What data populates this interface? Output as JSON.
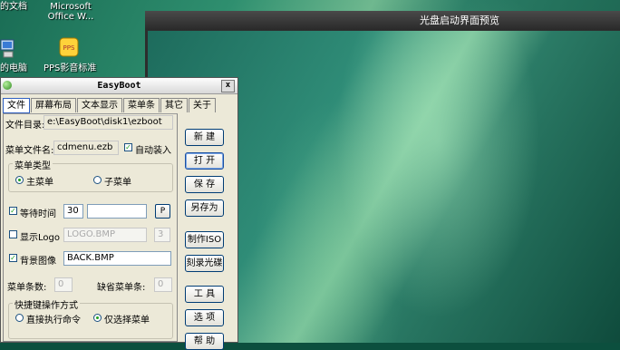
{
  "desktop": {
    "icons": [
      {
        "name": "my-documents",
        "label_lines": [
          "的文档"
        ]
      },
      {
        "name": "microsoft-office",
        "label_lines": [
          "Microsoft",
          "Office W..."
        ]
      },
      {
        "name": "my-computer",
        "label_lines": [
          "的电脑"
        ]
      },
      {
        "name": "pps-player",
        "label_lines": [
          "PPS影音标准"
        ]
      }
    ]
  },
  "preview": {
    "title": "光盘启动界面预览"
  },
  "easyboot": {
    "title": "EasyBoot",
    "close_label": "x",
    "tabs": [
      "文件",
      "屏幕布局",
      "文本显示",
      "菜单条",
      "其它",
      "关于"
    ],
    "file_dir_label": "文件目录:",
    "file_dir_value": "e:\\EasyBoot\\disk1\\ezboot",
    "menu_file_label": "菜单文件名:",
    "menu_file_value": "cdmenu.ezb",
    "auto_load_label": "自动装入",
    "menu_type_label": "菜单类型",
    "main_menu_label": "主菜单",
    "sub_menu_label": "子菜单",
    "wait_time_label": "等待时间",
    "wait_time_value": "30",
    "p_button_label": "P",
    "show_logo_label": "显示Logo",
    "logo_value": "LOGO.BMP",
    "logo_num_value": "3",
    "bg_image_label": "背景图像",
    "bg_image_value": "BACK.BMP",
    "menu_count_label": "菜单条数:",
    "menu_count_value": "0",
    "default_menu_label": "缺省菜单条:",
    "default_menu_value": "0",
    "hotkey_label": "快捷键操作方式",
    "direct_exec_label": "直接执行命令",
    "select_only_label": "仅选择菜单",
    "buttons": {
      "new": "新 建",
      "open": "打 开",
      "save": "保 存",
      "save_as": "另存为",
      "make_iso": "制作ISO",
      "burn_cd": "刻录光碟",
      "tools": "工 具",
      "options": "选 项",
      "help": "帮 助"
    }
  }
}
